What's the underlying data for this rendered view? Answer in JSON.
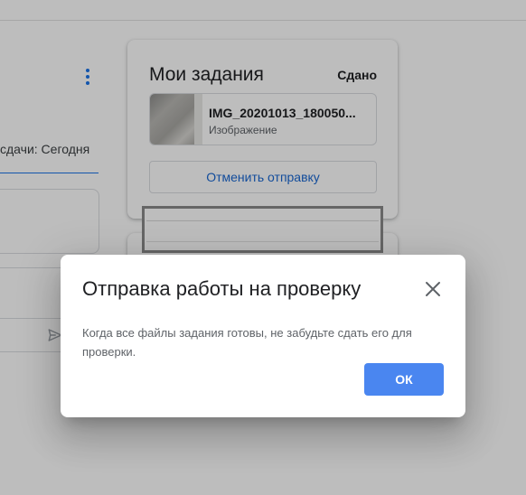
{
  "background": {
    "due_text": "сдачи: Сегодня"
  },
  "my_work": {
    "title": "Мои задания",
    "status": "Сдано",
    "attachment": {
      "name": "IMG_20201013_180050...",
      "type": "Изображение"
    },
    "unsubmit_label": "Отменить отправку"
  },
  "dialog": {
    "title": "Отправка работы на проверку",
    "body": "Когда все файлы задания готовы, не забудьте сдать его для проверки.",
    "ok_label": "ОК"
  },
  "colors": {
    "accent": "#1a73e8",
    "ok_button": "#4a86f0"
  }
}
